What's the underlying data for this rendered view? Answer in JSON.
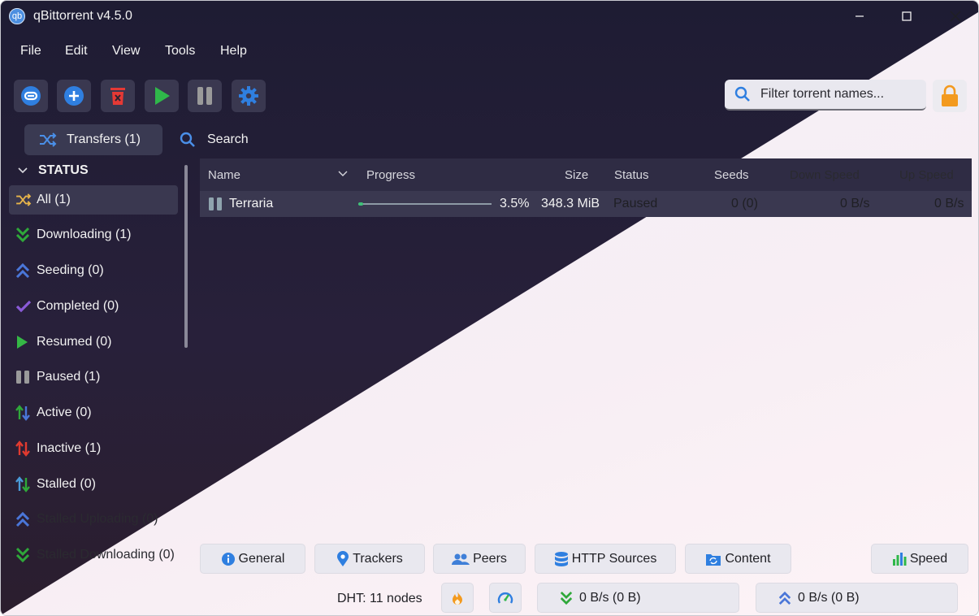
{
  "window": {
    "title": "qBittorrent v4.5.0",
    "app_icon_text": "qb"
  },
  "menu": [
    "File",
    "Edit",
    "View",
    "Tools",
    "Help"
  ],
  "toolbar": {
    "buttons": [
      "add-link",
      "add-torrent",
      "delete",
      "resume",
      "pause",
      "options"
    ],
    "filter_placeholder": "Filter torrent names..."
  },
  "tabs": {
    "transfers": "Transfers (1)",
    "search": "Search"
  },
  "sidebar": {
    "header": "STATUS",
    "items": [
      {
        "label": "All (1)",
        "icon": "shuffle-icon",
        "color": "#e8b54a",
        "selected": true
      },
      {
        "label": "Downloading (1)",
        "icon": "double-chevron-down-icon",
        "color": "#2fa83a"
      },
      {
        "label": "Seeding (0)",
        "icon": "double-chevron-up-icon",
        "color": "#4a76d8"
      },
      {
        "label": "Completed (0)",
        "icon": "checkmark-icon",
        "color": "#8a5ad8"
      },
      {
        "label": "Resumed (0)",
        "icon": "play-icon",
        "color": "#35b846"
      },
      {
        "label": "Paused (1)",
        "icon": "pause-icon",
        "color": "#9a9a9a"
      },
      {
        "label": "Active (0)",
        "icon": "arrows-up-down-icon",
        "color": "#2fa83a"
      },
      {
        "label": "Inactive (1)",
        "icon": "arrows-up-down-icon",
        "color": "#e03a2f"
      },
      {
        "label": "Stalled (0)",
        "icon": "arrows-up-down-icon",
        "color": "#4a9ad8"
      },
      {
        "label": "Stalled Uploading (0)",
        "icon": "double-chevron-up-icon",
        "color": "#4a76d8"
      },
      {
        "label": "Stalled Downloading (0)",
        "icon": "double-chevron-down-icon",
        "color": "#2fa83a"
      }
    ]
  },
  "table": {
    "columns": [
      "Name",
      "Progress",
      "Size",
      "Status",
      "Seeds",
      "Down Speed",
      "Up Speed"
    ],
    "rows": [
      {
        "name": "Terraria",
        "progress_value": 0.035,
        "progress_text": "3.5%",
        "size": "348.3 MiB",
        "status": "Paused",
        "seeds": "0 (0)",
        "down_speed": "0 B/s",
        "up_speed": "0 B/s"
      }
    ]
  },
  "bottom_tabs": [
    "General",
    "Trackers",
    "Peers",
    "HTTP Sources",
    "Content"
  ],
  "speed_tab": "Speed",
  "statusbar": {
    "dht": "DHT: 11 nodes",
    "download": "0 B/s (0 B)",
    "upload": "0 B/s (0 B)"
  },
  "colors": {
    "accent_blue": "#2f7fe0",
    "delete_red": "#e53935",
    "resume_green": "#2fb84a",
    "lock_orange": "#f39a1e"
  }
}
